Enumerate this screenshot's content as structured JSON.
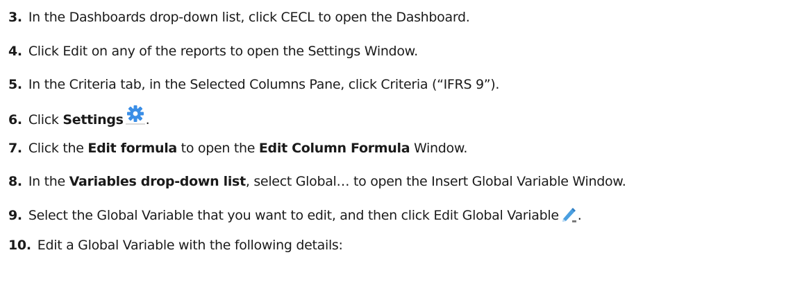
{
  "steps": [
    {
      "num": "3.",
      "parts": [
        "In the Dashboards drop-down list, click CECL to open the Dashboard."
      ]
    },
    {
      "num": "4.",
      "parts": [
        "Click Edit on any of the reports to open the Settings Window."
      ]
    },
    {
      "num": "5.",
      "parts": [
        "In the Criteria tab, in the Selected Columns Pane, click Criteria (“IFRS 9”)."
      ]
    },
    {
      "num": "6.",
      "parts": [
        "Click ",
        "Settings",
        "."
      ]
    },
    {
      "num": "7.",
      "parts": [
        "Click the ",
        "Edit formula",
        " to open the ",
        "Edit Column Formula",
        " Window."
      ]
    },
    {
      "num": "8.",
      "parts": [
        "In the ",
        "Variables drop-down list",
        ", select Global… to open the Insert Global Variable Window."
      ]
    },
    {
      "num": "9.",
      "parts": [
        "Select the Global Variable that you want to edit, and then click Edit Global Variable",
        "."
      ]
    },
    {
      "num": "10.",
      "parts": [
        "Edit a Global Variable with the following details:"
      ]
    }
  ],
  "icons": {
    "settings": "gear-icon",
    "edit": "pencil-icon",
    "gear_color": "#3a8ee6",
    "pencil_color": "#4a9fe0"
  }
}
